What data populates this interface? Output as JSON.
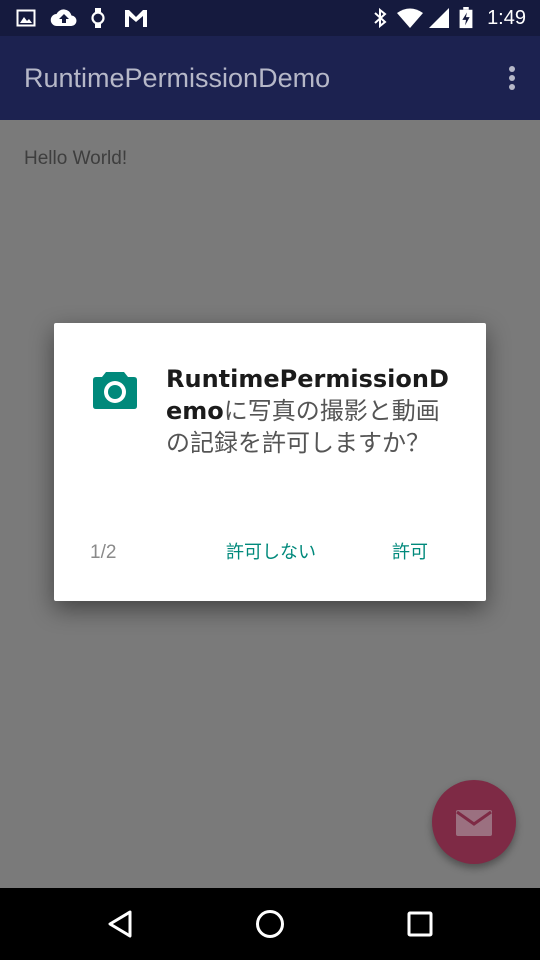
{
  "status_bar": {
    "time": "1:49",
    "icons": [
      "image-icon",
      "cloud-upload-icon",
      "watch-icon",
      "gmail-icon",
      "bluetooth-icon",
      "wifi-icon",
      "cell-signal-icon",
      "battery-charging-icon"
    ]
  },
  "app_bar": {
    "title": "RuntimePermissionDemo",
    "menu_icon": "overflow-menu-icon"
  },
  "main": {
    "text": "Hello World!"
  },
  "dialog": {
    "icon": "camera-icon",
    "app_name": "RuntimePermissionDemo",
    "message_rest": "に写真の撮影と動画の記録を許可しますか？",
    "counter": "1/2",
    "deny_label": "許可しない",
    "allow_label": "許可",
    "accent_color": "#00897b"
  },
  "fab": {
    "icon": "email-icon",
    "color": "#7e2a45"
  },
  "nav_bar": {
    "icons": [
      "back-icon",
      "home-icon",
      "recents-icon"
    ]
  },
  "colors": {
    "status_bar": "#151a3e",
    "app_bar": "#1c2250",
    "scrim_background": "#7a7a7a"
  }
}
